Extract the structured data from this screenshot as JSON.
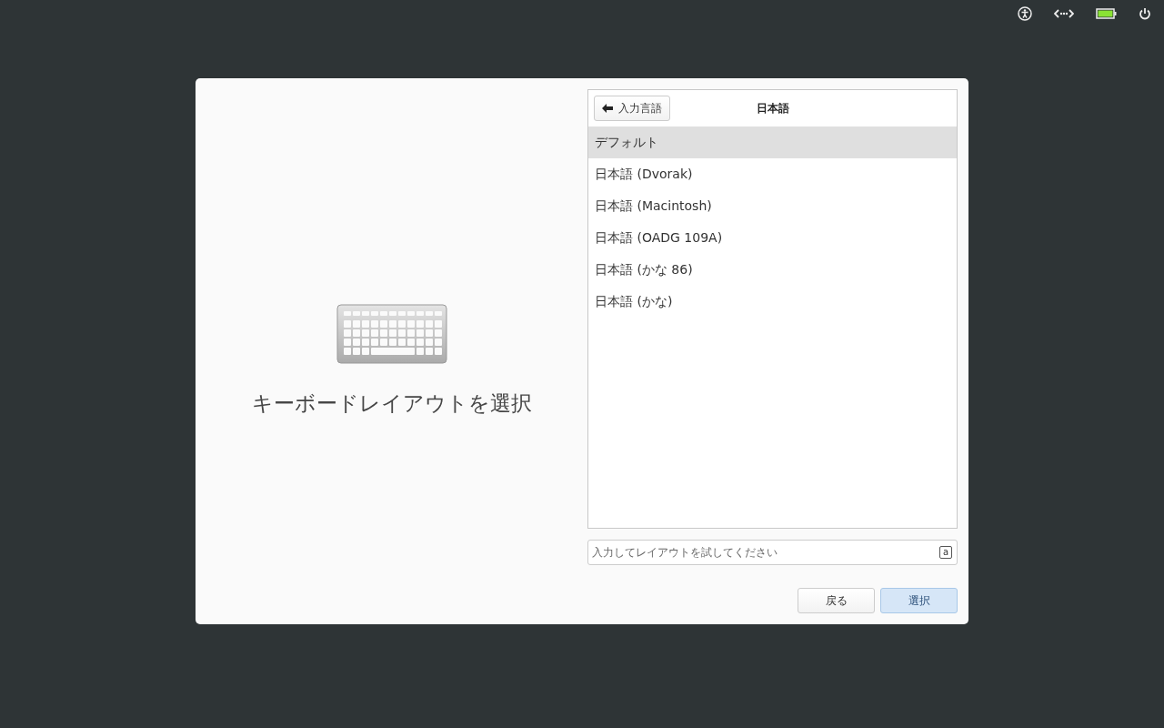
{
  "dialog": {
    "title": "キーボードレイアウトを選択"
  },
  "layout_list": {
    "back_button": "入力言語",
    "heading": "日本語",
    "items": [
      {
        "label": "デフォルト",
        "selected": true
      },
      {
        "label": "日本語 (Dvorak)",
        "selected": false
      },
      {
        "label": "日本語 (Macintosh)",
        "selected": false
      },
      {
        "label": "日本語 (OADG 109A)",
        "selected": false
      },
      {
        "label": "日本語 (かな 86)",
        "selected": false
      },
      {
        "label": "日本語 (かな)",
        "selected": false
      }
    ]
  },
  "test_field": {
    "placeholder": "入力してレイアウトを試してください",
    "key_hint": "a"
  },
  "buttons": [
    {
      "label": "戻る",
      "kind": "normal"
    },
    {
      "label": "選択",
      "kind": "suggested"
    }
  ]
}
